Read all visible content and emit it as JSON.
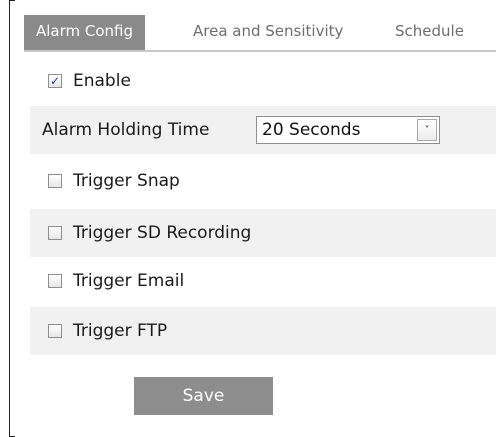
{
  "tabs": [
    {
      "label": "Alarm Config",
      "active": true
    },
    {
      "label": "Area and Sensitivity",
      "active": false
    },
    {
      "label": "Schedule",
      "active": false
    }
  ],
  "enable": {
    "label": "Enable",
    "checked": true
  },
  "alarm_holding_time": {
    "label": "Alarm Holding Time",
    "value": "20 Seconds"
  },
  "triggers": [
    {
      "label": "Trigger Snap",
      "checked": false
    },
    {
      "label": "Trigger SD Recording",
      "checked": false
    },
    {
      "label": "Trigger Email",
      "checked": false
    },
    {
      "label": "Trigger FTP",
      "checked": false
    }
  ],
  "save_label": "Save",
  "icons": {
    "checked": "✓",
    "dropdown": "˅"
  },
  "colors": {
    "active_tab": "#8a8a8a",
    "save_button": "#8d8d8d",
    "row_shade": "#f1f1f1",
    "check_mark": "#2548a8"
  }
}
